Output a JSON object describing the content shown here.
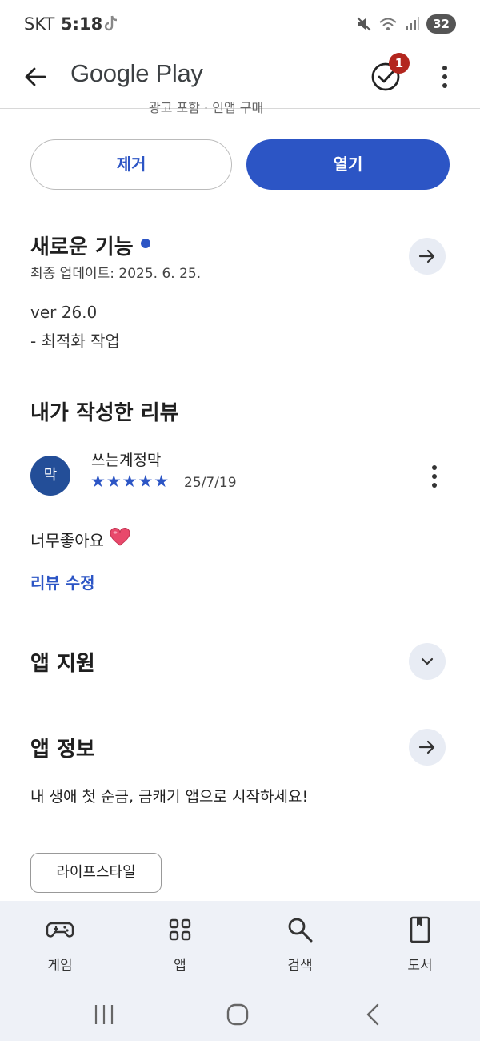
{
  "status_bar": {
    "carrier": "SKT",
    "time": "5:18",
    "battery": "32"
  },
  "app_bar": {
    "title": "Google Play",
    "badge_count": "1"
  },
  "cut_text": "광고 포함 · 인앱 구매",
  "actions": {
    "remove_label": "제거",
    "open_label": "열기"
  },
  "whats_new": {
    "title": "새로운 기능",
    "updated": "최종 업데이트: 2025. 6. 25.",
    "version": "ver 26.0",
    "note": "- 최적화 작업"
  },
  "my_review": {
    "title": "내가 작성한 리뷰",
    "avatar_letter": "막",
    "reviewer": "쓰는계정막",
    "stars": "★★★★★",
    "rating": 5,
    "date": "25/7/19",
    "text": "너무좋아요",
    "edit_label": "리뷰 수정"
  },
  "app_support": {
    "title": "앱 지원"
  },
  "app_info": {
    "title": "앱 정보",
    "description": "내 생애 첫 순금, 금캐기 앱으로 시작하세요!",
    "category": "라이프스타일"
  },
  "bottom_nav": {
    "items": [
      {
        "label": "게임",
        "icon": "gamepad-icon"
      },
      {
        "label": "앱",
        "icon": "apps-grid-icon"
      },
      {
        "label": "검색",
        "icon": "search-icon"
      },
      {
        "label": "도서",
        "icon": "book-icon"
      }
    ]
  },
  "colors": {
    "accent": "#2c55c5",
    "avatar": "#234e98",
    "badge": "#b3261e",
    "nav_bg": "#eef1f7"
  }
}
